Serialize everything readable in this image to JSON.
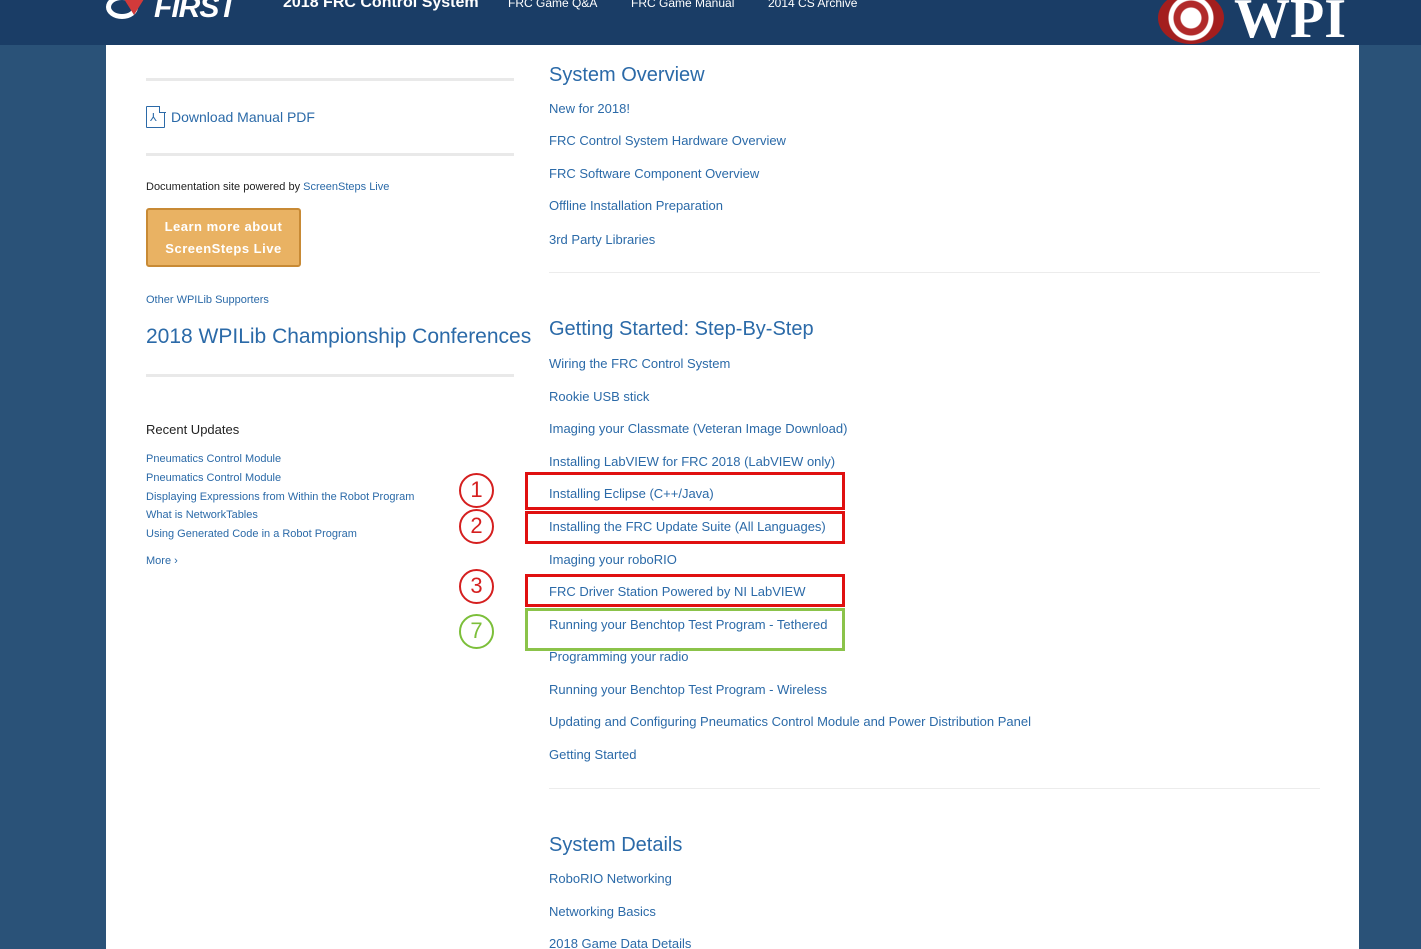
{
  "header": {
    "brand": "FIRST",
    "title": "2018 FRC Control System",
    "nav": [
      "FRC Game Q&A",
      "FRC Game Manual",
      "2014 CS Archive"
    ],
    "partner": "WPI"
  },
  "sidebar": {
    "download_label": "Download Manual PDF",
    "powered_prefix": "Documentation site powered by ",
    "powered_link": "ScreenSteps Live",
    "learn_button": [
      "Learn more about",
      "ScreenSteps Live"
    ],
    "supporters_label": "Other WPILib Supporters",
    "conference_link": "2018 WPILib Championship Conferences",
    "recent_title": "Recent Updates",
    "recent_items": [
      "Pneumatics Control Module",
      "Pneumatics Control Module",
      "Displaying Expressions from Within the Robot Program",
      "What is NetworkTables",
      "Using Generated Code in a Robot Program"
    ],
    "more_label": "More"
  },
  "sections": [
    {
      "title": "System Overview",
      "items": [
        "New for 2018!",
        "FRC Control System Hardware Overview",
        "FRC Software Component Overview",
        "Offline Installation Preparation",
        "3rd Party Libraries"
      ]
    },
    {
      "title": "Getting Started: Step-By-Step",
      "items": [
        "Wiring the FRC Control System",
        "Rookie USB stick",
        "Imaging your Classmate (Veteran Image Download)",
        "Installing LabVIEW for FRC 2018 (LabVIEW only)",
        "Installing Eclipse (C++/Java)",
        "Installing the FRC Update Suite (All Languages)",
        "Imaging your roboRIO",
        "FRC Driver Station Powered by NI LabVIEW",
        "Running your Benchtop Test Program - Tethered",
        "Programming your radio",
        "Running your Benchtop Test Program - Wireless",
        "Updating and Configuring Pneumatics Control Module and Power Distribution Panel",
        "Getting Started"
      ]
    },
    {
      "title": "System Details",
      "items": [
        "RoboRIO Networking",
        "Networking Basics",
        "2018 Game Data Details"
      ]
    }
  ],
  "annotations": {
    "badges": [
      "1",
      "2",
      "3",
      "7"
    ],
    "colors": {
      "red": "#e01010",
      "green": "#8bc34a"
    }
  }
}
